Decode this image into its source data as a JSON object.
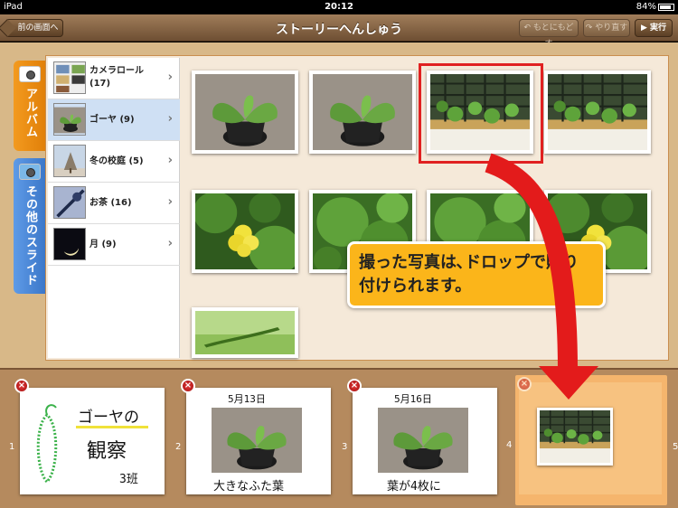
{
  "status": {
    "carrier": "iPad",
    "time": "20:12",
    "battery": "84%"
  },
  "nav": {
    "back": "前の画面へ",
    "title": "ストーリーへんしゅう",
    "undo": "もとにもどす",
    "redo": "やり直す",
    "run": "実行"
  },
  "tabs": {
    "album": "アルバム",
    "slides": "その他のスライド"
  },
  "albums": [
    {
      "label": "カメラロール (17)"
    },
    {
      "label": "ゴーヤ (9)"
    },
    {
      "label": "冬の校庭 (5)"
    },
    {
      "label": "お茶 (16)"
    },
    {
      "label": "月 (9)"
    }
  ],
  "callout": "撮った写真は､ドロップで貼り付けられます。",
  "slides": [
    {
      "num": "1",
      "l1": "ゴーヤの",
      "l2": "観察",
      "l3": "3班"
    },
    {
      "num": "2",
      "date": "5月13日",
      "caption": "大きなふた葉"
    },
    {
      "num": "3",
      "date": "5月16日",
      "caption": "葉が4枚に"
    },
    {
      "num": "4"
    },
    {
      "num": "5"
    }
  ],
  "colors": {
    "highlight": "#e02121",
    "accent": "#fbb51a",
    "album_tab": "#f39a1f",
    "slides_tab": "#3b76c8"
  }
}
